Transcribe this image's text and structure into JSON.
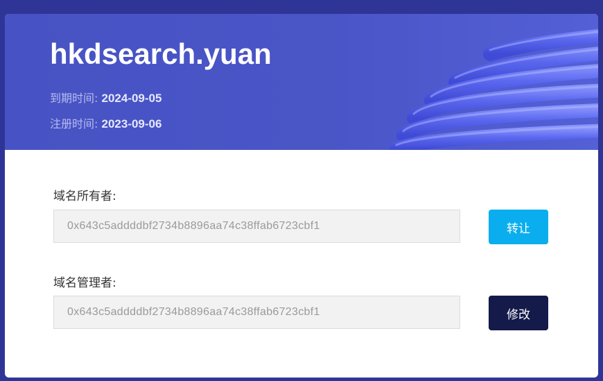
{
  "domain": {
    "name": "hkdsearch.yuan"
  },
  "expiry": {
    "label": "到期时间:",
    "value": "2024-09-05"
  },
  "registration": {
    "label": "注册时间:",
    "value": "2023-09-06"
  },
  "owner": {
    "label": "域名所有者:",
    "address": "0x643c5addddbf2734b8896aa74c38ffab6723cbf1",
    "button_label": "转让"
  },
  "manager": {
    "label": "域名管理者:",
    "address": "0x643c5addddbf2734b8896aa74c38ffab6723cbf1",
    "button_label": "修改"
  },
  "colors": {
    "page_background": "#2f3596",
    "header_background": "#4a55c6",
    "transfer_button": "#0aaeef",
    "modify_button": "#141a4a"
  },
  "icons": {
    "header_decoration": "coil-decoration"
  }
}
